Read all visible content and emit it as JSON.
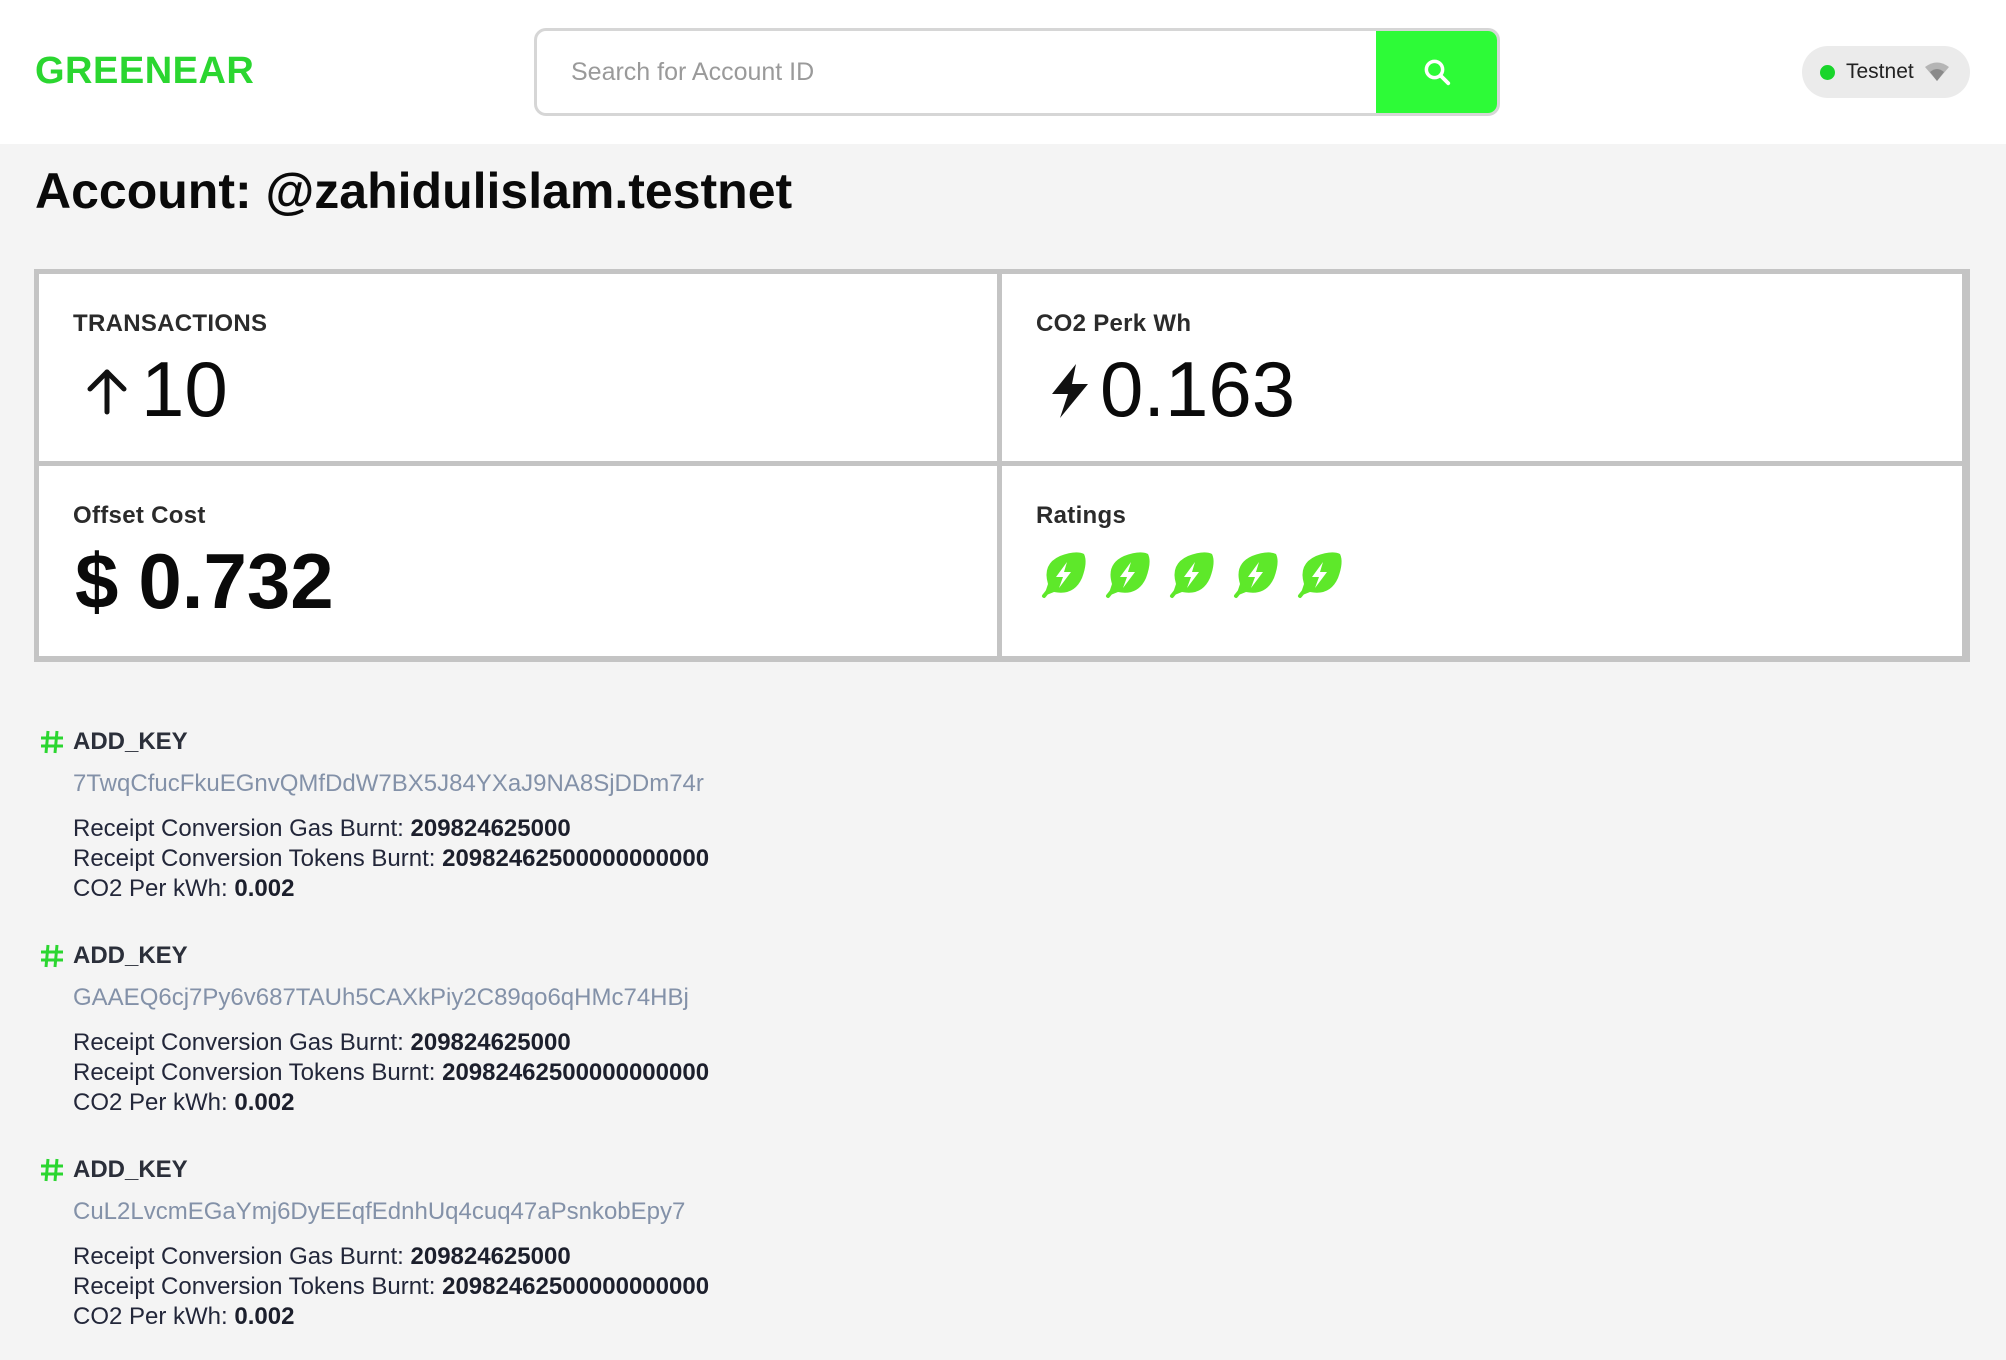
{
  "header": {
    "logo": "GREENEAR",
    "search": {
      "placeholder": "Search for Account ID",
      "value": ""
    },
    "network": "Testnet"
  },
  "page": {
    "title": "Account: @zahidulislam.testnet"
  },
  "stats": {
    "transactions": {
      "label": "TRANSACTIONS",
      "value": "10"
    },
    "co2": {
      "label": "CO2 Perk Wh",
      "value": "0.163"
    },
    "offset": {
      "label": "Offset Cost",
      "prefix": "$",
      "value": "0.732"
    },
    "ratings": {
      "label": "Ratings",
      "count": 5,
      "max": 5
    }
  },
  "transactions": [
    {
      "type": "ADD_KEY",
      "hash": "7TwqCfucFkuEGnvQMfDdW7BX5J84YXaJ9NA8SjDDm74r",
      "gas_label": "Receipt Conversion Gas Burnt:",
      "gas_value": "209824625000",
      "tokens_label": "Receipt Conversion Tokens Burnt:",
      "tokens_value": "20982462500000000000",
      "co2_label": "CO2 Per kWh:",
      "co2_value": "0.002"
    },
    {
      "type": "ADD_KEY",
      "hash": "GAAEQ6cj7Py6v687TAUh5CAXkPiy2C89qo6qHMc74HBj",
      "gas_label": "Receipt Conversion Gas Burnt:",
      "gas_value": "209824625000",
      "tokens_label": "Receipt Conversion Tokens Burnt:",
      "tokens_value": "20982462500000000000",
      "co2_label": "CO2 Per kWh:",
      "co2_value": "0.002"
    },
    {
      "type": "ADD_KEY",
      "hash": "CuL2LvcmEGaYmj6DyEEqfEdnhUq4cuq47aPsnkobEpy7",
      "gas_label": "Receipt Conversion Gas Burnt:",
      "gas_value": "209824625000",
      "tokens_label": "Receipt Conversion Tokens Burnt:",
      "tokens_value": "20982462500000000000",
      "co2_label": "CO2 Per kWh:",
      "co2_value": "0.002"
    }
  ],
  "icons": {
    "search": "search-icon",
    "network": "wifi-icon",
    "transactions": "arrow-up-icon",
    "co2": "lightning-icon",
    "rating": "leaf-lightning-icon",
    "tx": "hash-icon"
  },
  "colors": {
    "brand": "#2bd630",
    "search_button": "#2dfb37",
    "rating_leaf": "#5ee82a",
    "network_dot": "#19d52b",
    "hash_text": "#8391a8"
  }
}
